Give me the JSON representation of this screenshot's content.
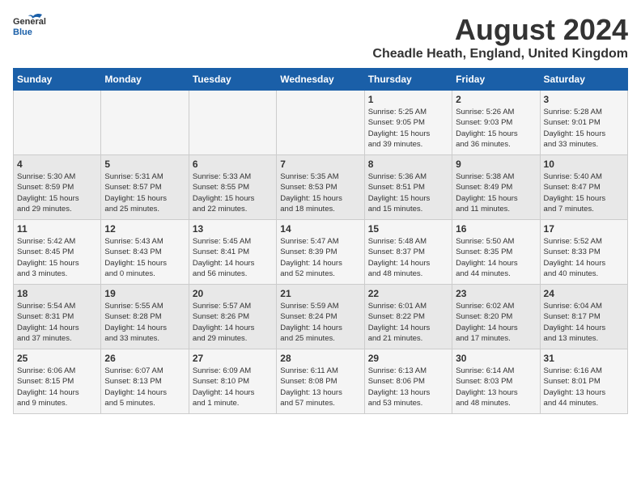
{
  "logo": {
    "general": "General",
    "blue": "Blue"
  },
  "title": "August 2024",
  "subtitle": "Cheadle Heath, England, United Kingdom",
  "days_of_week": [
    "Sunday",
    "Monday",
    "Tuesday",
    "Wednesday",
    "Thursday",
    "Friday",
    "Saturday"
  ],
  "weeks": [
    [
      {
        "day": "",
        "info": ""
      },
      {
        "day": "",
        "info": ""
      },
      {
        "day": "",
        "info": ""
      },
      {
        "day": "",
        "info": ""
      },
      {
        "day": "1",
        "info": "Sunrise: 5:25 AM\nSunset: 9:05 PM\nDaylight: 15 hours\nand 39 minutes."
      },
      {
        "day": "2",
        "info": "Sunrise: 5:26 AM\nSunset: 9:03 PM\nDaylight: 15 hours\nand 36 minutes."
      },
      {
        "day": "3",
        "info": "Sunrise: 5:28 AM\nSunset: 9:01 PM\nDaylight: 15 hours\nand 33 minutes."
      }
    ],
    [
      {
        "day": "4",
        "info": "Sunrise: 5:30 AM\nSunset: 8:59 PM\nDaylight: 15 hours\nand 29 minutes."
      },
      {
        "day": "5",
        "info": "Sunrise: 5:31 AM\nSunset: 8:57 PM\nDaylight: 15 hours\nand 25 minutes."
      },
      {
        "day": "6",
        "info": "Sunrise: 5:33 AM\nSunset: 8:55 PM\nDaylight: 15 hours\nand 22 minutes."
      },
      {
        "day": "7",
        "info": "Sunrise: 5:35 AM\nSunset: 8:53 PM\nDaylight: 15 hours\nand 18 minutes."
      },
      {
        "day": "8",
        "info": "Sunrise: 5:36 AM\nSunset: 8:51 PM\nDaylight: 15 hours\nand 15 minutes."
      },
      {
        "day": "9",
        "info": "Sunrise: 5:38 AM\nSunset: 8:49 PM\nDaylight: 15 hours\nand 11 minutes."
      },
      {
        "day": "10",
        "info": "Sunrise: 5:40 AM\nSunset: 8:47 PM\nDaylight: 15 hours\nand 7 minutes."
      }
    ],
    [
      {
        "day": "11",
        "info": "Sunrise: 5:42 AM\nSunset: 8:45 PM\nDaylight: 15 hours\nand 3 minutes."
      },
      {
        "day": "12",
        "info": "Sunrise: 5:43 AM\nSunset: 8:43 PM\nDaylight: 15 hours\nand 0 minutes."
      },
      {
        "day": "13",
        "info": "Sunrise: 5:45 AM\nSunset: 8:41 PM\nDaylight: 14 hours\nand 56 minutes."
      },
      {
        "day": "14",
        "info": "Sunrise: 5:47 AM\nSunset: 8:39 PM\nDaylight: 14 hours\nand 52 minutes."
      },
      {
        "day": "15",
        "info": "Sunrise: 5:48 AM\nSunset: 8:37 PM\nDaylight: 14 hours\nand 48 minutes."
      },
      {
        "day": "16",
        "info": "Sunrise: 5:50 AM\nSunset: 8:35 PM\nDaylight: 14 hours\nand 44 minutes."
      },
      {
        "day": "17",
        "info": "Sunrise: 5:52 AM\nSunset: 8:33 PM\nDaylight: 14 hours\nand 40 minutes."
      }
    ],
    [
      {
        "day": "18",
        "info": "Sunrise: 5:54 AM\nSunset: 8:31 PM\nDaylight: 14 hours\nand 37 minutes."
      },
      {
        "day": "19",
        "info": "Sunrise: 5:55 AM\nSunset: 8:28 PM\nDaylight: 14 hours\nand 33 minutes."
      },
      {
        "day": "20",
        "info": "Sunrise: 5:57 AM\nSunset: 8:26 PM\nDaylight: 14 hours\nand 29 minutes."
      },
      {
        "day": "21",
        "info": "Sunrise: 5:59 AM\nSunset: 8:24 PM\nDaylight: 14 hours\nand 25 minutes."
      },
      {
        "day": "22",
        "info": "Sunrise: 6:01 AM\nSunset: 8:22 PM\nDaylight: 14 hours\nand 21 minutes."
      },
      {
        "day": "23",
        "info": "Sunrise: 6:02 AM\nSunset: 8:20 PM\nDaylight: 14 hours\nand 17 minutes."
      },
      {
        "day": "24",
        "info": "Sunrise: 6:04 AM\nSunset: 8:17 PM\nDaylight: 14 hours\nand 13 minutes."
      }
    ],
    [
      {
        "day": "25",
        "info": "Sunrise: 6:06 AM\nSunset: 8:15 PM\nDaylight: 14 hours\nand 9 minutes."
      },
      {
        "day": "26",
        "info": "Sunrise: 6:07 AM\nSunset: 8:13 PM\nDaylight: 14 hours\nand 5 minutes."
      },
      {
        "day": "27",
        "info": "Sunrise: 6:09 AM\nSunset: 8:10 PM\nDaylight: 14 hours\nand 1 minute."
      },
      {
        "day": "28",
        "info": "Sunrise: 6:11 AM\nSunset: 8:08 PM\nDaylight: 13 hours\nand 57 minutes."
      },
      {
        "day": "29",
        "info": "Sunrise: 6:13 AM\nSunset: 8:06 PM\nDaylight: 13 hours\nand 53 minutes."
      },
      {
        "day": "30",
        "info": "Sunrise: 6:14 AM\nSunset: 8:03 PM\nDaylight: 13 hours\nand 48 minutes."
      },
      {
        "day": "31",
        "info": "Sunrise: 6:16 AM\nSunset: 8:01 PM\nDaylight: 13 hours\nand 44 minutes."
      }
    ]
  ]
}
